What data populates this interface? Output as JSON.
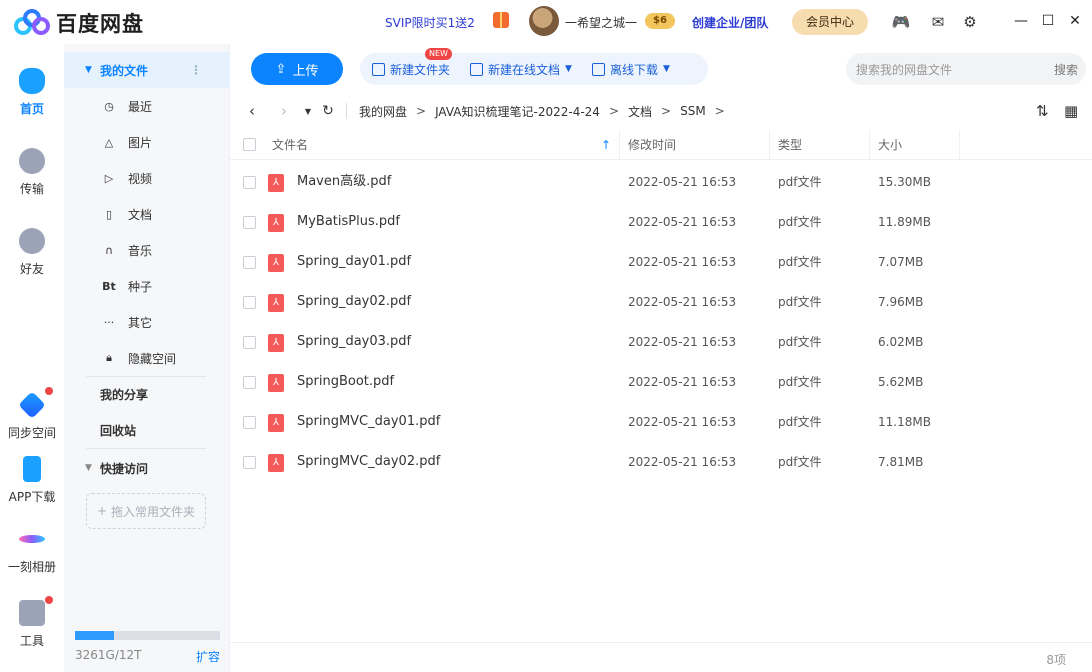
{
  "app": {
    "name": "百度网盘"
  },
  "header": {
    "promo": "SVIP限时买1送2",
    "username": "一希望之城一",
    "level_badge": "$6",
    "enterprise": "创建企业/团队",
    "member_center": "会员中心",
    "icons": [
      "gift-icon",
      "game-icon",
      "mail-icon",
      "settings-icon",
      "minimize-icon",
      "maximize-icon",
      "close-icon"
    ]
  },
  "rail": {
    "items": [
      {
        "label": "首页",
        "icon": "cloud-icon",
        "active": true
      },
      {
        "label": "传输",
        "icon": "transfer-icon"
      },
      {
        "label": "好友",
        "icon": "friends-icon"
      },
      {
        "label": "同步空间",
        "icon": "sync-icon"
      },
      {
        "label": "APP下载",
        "icon": "phone-icon"
      },
      {
        "label": "一刻相册",
        "icon": "album-icon"
      },
      {
        "label": "工具",
        "icon": "tools-icon"
      }
    ]
  },
  "sidebar": {
    "my_files": "我的文件",
    "categories": [
      {
        "label": "最近",
        "icon": "clock-icon"
      },
      {
        "label": "图片",
        "icon": "image-icon"
      },
      {
        "label": "视频",
        "icon": "video-icon"
      },
      {
        "label": "文档",
        "icon": "document-icon"
      },
      {
        "label": "音乐",
        "icon": "music-icon"
      },
      {
        "label": "种子",
        "icon": "torrent-icon"
      },
      {
        "label": "其它",
        "icon": "more-icon"
      },
      {
        "label": "隐藏空间",
        "icon": "lock-icon"
      }
    ],
    "my_share": "我的分享",
    "recycle": "回收站",
    "quick_access": "快捷访问",
    "add_fav": "拖入常用文件夹",
    "quota": "3261G/12T",
    "quota_used_fraction": 0.27,
    "expand": "扩容"
  },
  "toolbar": {
    "upload": "上传",
    "new_folder": "新建文件夹",
    "new_online_doc": "新建在线文档",
    "new_badge": "NEW",
    "offline_download": "离线下载",
    "search_placeholder": "搜索我的网盘文件",
    "search_button": "搜索"
  },
  "breadcrumb": [
    "我的网盘",
    "JAVA知识梳理笔记-2022-4-24",
    "文档",
    "SSM"
  ],
  "table": {
    "columns": [
      "文件名",
      "修改时间",
      "类型",
      "大小"
    ],
    "rows": [
      {
        "name": "Maven高级.pdf",
        "time": "2022-05-21 16:53",
        "type": "pdf文件",
        "size": "15.30MB"
      },
      {
        "name": "MyBatisPlus.pdf",
        "time": "2022-05-21 16:53",
        "type": "pdf文件",
        "size": "11.89MB"
      },
      {
        "name": "Spring_day01.pdf",
        "time": "2022-05-21 16:53",
        "type": "pdf文件",
        "size": "7.07MB"
      },
      {
        "name": "Spring_day02.pdf",
        "time": "2022-05-21 16:53",
        "type": "pdf文件",
        "size": "7.96MB"
      },
      {
        "name": "Spring_day03.pdf",
        "time": "2022-05-21 16:53",
        "type": "pdf文件",
        "size": "6.02MB"
      },
      {
        "name": "SpringBoot.pdf",
        "time": "2022-05-21 16:53",
        "type": "pdf文件",
        "size": "5.62MB"
      },
      {
        "name": "SpringMVC_day01.pdf",
        "time": "2022-05-21 16:53",
        "type": "pdf文件",
        "size": "11.18MB"
      },
      {
        "name": "SpringMVC_day02.pdf",
        "time": "2022-05-21 16:53",
        "type": "pdf文件",
        "size": "7.81MB"
      }
    ]
  },
  "footer": {
    "count": "8项"
  },
  "colors": {
    "accent": "#0d84ff",
    "promo": "#2b3ad3",
    "member_bg": "#f7dcb0",
    "pdf": "#f45a5a"
  }
}
